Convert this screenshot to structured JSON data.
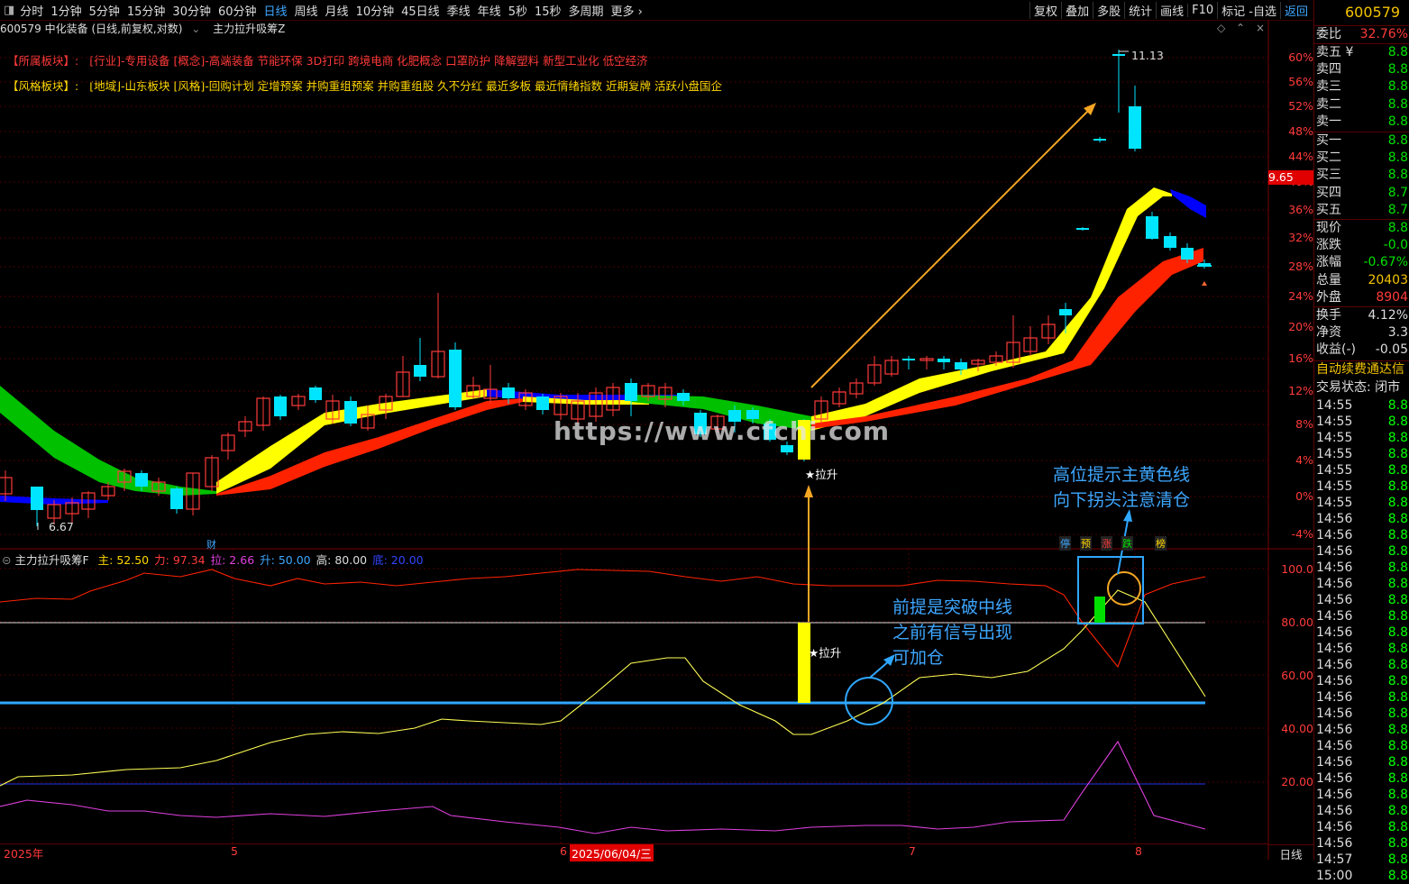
{
  "toolbar": {
    "timeframes": [
      "分时",
      "1分钟",
      "5分钟",
      "15分钟",
      "30分钟",
      "60分钟",
      "日线",
      "周线",
      "月线",
      "10分钟",
      "45日线",
      "季线",
      "年线",
      "5秒",
      "15秒",
      "多周期",
      "更多 ›"
    ],
    "selected": "日线",
    "right_buttons": [
      "复权",
      "叠加",
      "多股",
      "统计",
      "画线",
      "F10",
      "标记 -自选"
    ],
    "back": "返回"
  },
  "header": {
    "title": "600579 中化装备 (日线,前复权,对数)",
    "indicator": "主力拉升吸筹Z"
  },
  "sector": {
    "label": "【所属板块】:",
    "text": "[行业]-专用设备 [概念]-高端装备 节能环保 3D打印 跨境电商 化肥概念 口罩防护 降解塑料 新型工业化 低空经济"
  },
  "style": {
    "label": "【风格板块】:",
    "text": "[地域]-山东板块 [风格]-回购计划 定增预案 并购重组预案 并购重组股 久不分红 最近多板 最近情绪指数 近期复牌 活跃小盘国企"
  },
  "price_axis": {
    "labels": [
      "60%",
      "56%",
      "52%",
      "48%",
      "44%",
      "40%",
      "36%",
      "32%",
      "28%",
      "24%",
      "20%",
      "16%",
      "12%",
      "8%",
      "4%",
      "0%",
      "-4%"
    ],
    "current_price": "9.65",
    "high_label": "11.13",
    "low_label": "6.67"
  },
  "indicator_bar": {
    "name": "主力拉升吸筹F",
    "items": [
      {
        "k": "主:",
        "v": "52.50",
        "color": "#ffd800"
      },
      {
        "k": "力:",
        "v": "97.34",
        "color": "#ff3a3a"
      },
      {
        "k": "拉:",
        "v": "2.66",
        "color": "#e040e0"
      },
      {
        "k": "升:",
        "v": "50.00",
        "color": "#3ea7ff"
      },
      {
        "k": "高:",
        "v": "80.00",
        "color": "#dddddd"
      },
      {
        "k": "底:",
        "v": "20.00",
        "color": "#3344ff"
      }
    ],
    "axis": [
      "100.0",
      "80.00",
      "60.00",
      "40.00",
      "20.00"
    ]
  },
  "markers": {
    "lashen1": "★拉升",
    "lashen2": "★拉升",
    "cai": "财",
    "tags": [
      "停",
      "预",
      "涨",
      "跌",
      "榜"
    ]
  },
  "notes": {
    "note1_l1": "高位提示主黄色线",
    "note1_l2": "向下拐头注意清仓",
    "note2_l1": "前提是突破中线",
    "note2_l2": "之前有信号出现",
    "note2_l3": "可加仓"
  },
  "watermark": "https://www.cfchi.com",
  "datebar": {
    "year": "2025年",
    "m5": "5",
    "m6": "6",
    "date": "2025/06/04/三",
    "m7": "7",
    "m8": "8",
    "period": "日线"
  },
  "rpanel": {
    "code": "600579",
    "weibi_k": "委比",
    "weibi_v": "32.76%",
    "sell": [
      {
        "k": "卖五 ¥",
        "v": "8.8"
      },
      {
        "k": "卖四",
        "v": "8.8"
      },
      {
        "k": "卖三",
        "v": "8.8"
      },
      {
        "k": "卖二",
        "v": "8.8"
      },
      {
        "k": "卖一",
        "v": "8.8"
      }
    ],
    "buy": [
      {
        "k": "买一",
        "v": "8.8"
      },
      {
        "k": "买二",
        "v": "8.8"
      },
      {
        "k": "买三",
        "v": "8.8"
      },
      {
        "k": "买四",
        "v": "8.7"
      },
      {
        "k": "买五",
        "v": "8.7"
      }
    ],
    "quote": [
      {
        "k": "现价",
        "v": "8.8",
        "c": "#00e000"
      },
      {
        "k": "涨跌",
        "v": "-0.0",
        "c": "#00e000"
      },
      {
        "k": "涨幅",
        "v": "-0.67%",
        "c": "#00e000"
      },
      {
        "k": "总量",
        "v": "20403",
        "c": "#f5c400"
      },
      {
        "k": "外盘",
        "v": "8904",
        "c": "#ff3a3a"
      }
    ],
    "stats": [
      {
        "k": "换手",
        "v": "4.12%",
        "c": "#dddddd"
      },
      {
        "k": "净资",
        "v": "3.3",
        "c": "#dddddd"
      },
      {
        "k": "收益(-)",
        "v": "-0.05",
        "c": "#dddddd"
      }
    ],
    "auto": "自动续费通达信",
    "trade_state": "交易状态: 闭市",
    "ticks": [
      {
        "t": "14:55",
        "p": "8.8"
      },
      {
        "t": "14:55",
        "p": "8.8"
      },
      {
        "t": "14:55",
        "p": "8.8"
      },
      {
        "t": "14:55",
        "p": "8.8"
      },
      {
        "t": "14:55",
        "p": "8.8"
      },
      {
        "t": "14:55",
        "p": "8.8"
      },
      {
        "t": "14:55",
        "p": "8.8"
      },
      {
        "t": "14:56",
        "p": "8.8"
      },
      {
        "t": "14:56",
        "p": "8.8"
      },
      {
        "t": "14:56",
        "p": "8.8"
      },
      {
        "t": "14:56",
        "p": "8.8"
      },
      {
        "t": "14:56",
        "p": "8.8"
      },
      {
        "t": "14:56",
        "p": "8.8"
      },
      {
        "t": "14:56",
        "p": "8.8"
      },
      {
        "t": "14:56",
        "p": "8.8"
      },
      {
        "t": "14:56",
        "p": "8.8"
      },
      {
        "t": "14:56",
        "p": "8.8"
      },
      {
        "t": "14:56",
        "p": "8.8"
      },
      {
        "t": "14:56",
        "p": "8.8"
      },
      {
        "t": "14:56",
        "p": "8.8"
      },
      {
        "t": "14:56",
        "p": "8.8"
      },
      {
        "t": "14:56",
        "p": "8.8"
      },
      {
        "t": "14:56",
        "p": "8.8"
      },
      {
        "t": "14:56",
        "p": "8.8"
      },
      {
        "t": "14:56",
        "p": "8.8"
      },
      {
        "t": "14:56",
        "p": "8.8"
      },
      {
        "t": "14:56",
        "p": "8.8"
      },
      {
        "t": "14:56",
        "p": "8.8"
      },
      {
        "t": "14:57",
        "p": "8.8"
      },
      {
        "t": "15:00",
        "p": "8.8"
      }
    ]
  },
  "colors": {
    "up": "#ff3a3a",
    "down": "#00e5ff",
    "ribbon_fast": "#ffff00",
    "ribbon_slow": "#ff2200",
    "ribbon_green": "#00c000",
    "ribbon_blue": "#0000ff"
  }
}
